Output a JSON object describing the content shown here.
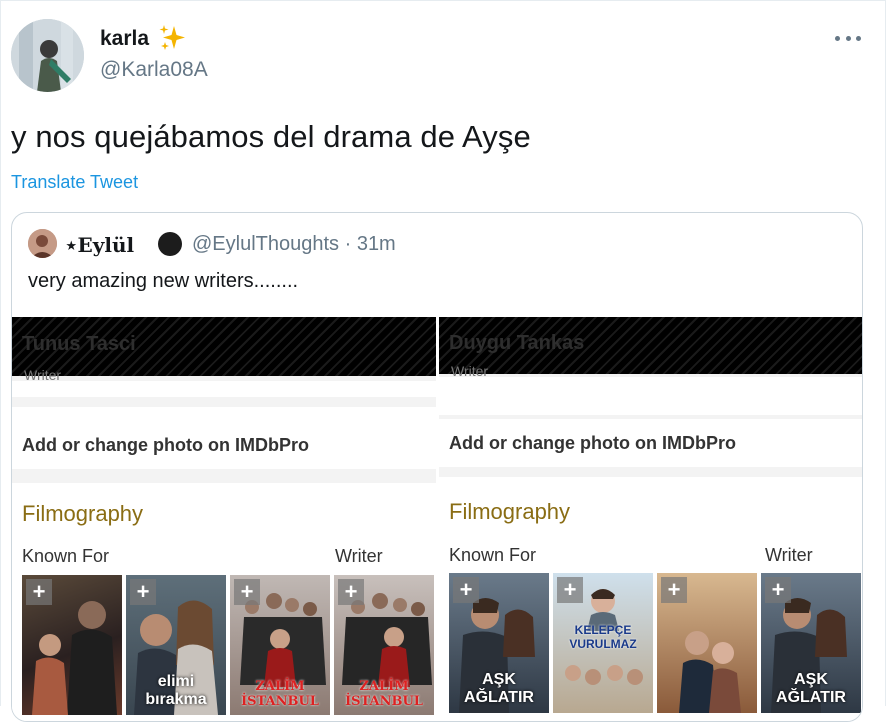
{
  "author": {
    "display_name": "karla",
    "emoji": "✨",
    "handle": "@Karla08A"
  },
  "tweet": {
    "text": "y nos quejábamos del drama de Ayşe",
    "translate_label": "Translate Tweet"
  },
  "quoted": {
    "name": "⋆Eylül",
    "handle_time": "@EylulThoughts · 31m",
    "text": "very amazing new writers........",
    "left_panel": {
      "person": "Tunus Tasci",
      "role": "Writer",
      "add_photo": "Add or change photo on IMDbPro",
      "filmography": "Filmography",
      "known_for": "Known For",
      "writer": "Writer",
      "posters": [
        {
          "title": "",
          "plus": "+"
        },
        {
          "title": "elimi bırakma",
          "plus": "+"
        },
        {
          "title": "ZALİM İSTANBUL",
          "plus": "+"
        },
        {
          "title": "ZALİM İSTANBUL",
          "plus": "+"
        }
      ]
    },
    "right_panel": {
      "person": "Duygu Tankas",
      "role": "Writer",
      "add_photo": "Add or change photo on IMDbPro",
      "filmography": "Filmography",
      "known_for": "Known For",
      "writer": "Writer",
      "posters": [
        {
          "title": "AŞK AĞLATIR",
          "plus": "+"
        },
        {
          "title": "KELEPÇE VURULMAZ",
          "plus": "+"
        },
        {
          "title": "",
          "plus": "+"
        },
        {
          "title": "AŞK AĞLATIR",
          "plus": "+"
        }
      ]
    }
  },
  "colors": {
    "link": "#1b95e0",
    "secondary_text": "#657786",
    "filmography": "#8a6d14"
  }
}
